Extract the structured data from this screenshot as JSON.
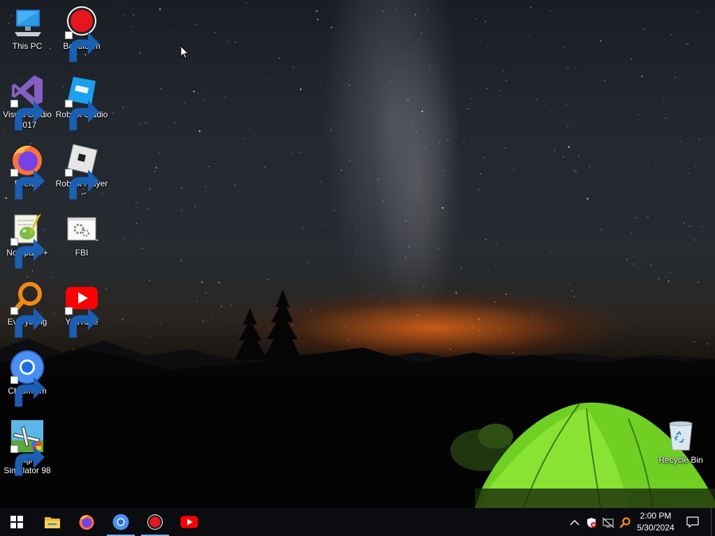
{
  "desktop": {
    "icons": [
      {
        "label": "This PC",
        "icon": "this-pc-icon"
      },
      {
        "label": "Bandicam",
        "icon": "bandicam-icon"
      },
      {
        "label": "Visual Studio\n2017",
        "icon": "visual-studio-icon"
      },
      {
        "label": "Roblox Studio",
        "icon": "roblox-studio-icon"
      },
      {
        "label": "Firefox",
        "icon": "firefox-icon"
      },
      {
        "label": "Roblox Player",
        "icon": "roblox-player-icon"
      },
      {
        "label": "Notepad++",
        "icon": "notepad-plus-plus-icon"
      },
      {
        "label": "FBI",
        "icon": "fbi-app-icon"
      },
      {
        "label": "Everything",
        "icon": "everything-search-icon"
      },
      {
        "label": "YouTube",
        "icon": "youtube-icon"
      },
      {
        "label": "Chromium",
        "icon": "chromium-icon"
      },
      {
        "label": "Flight\nSimulator 98",
        "icon": "flight-simulator-icon"
      },
      {
        "label": "Recycle Bin",
        "icon": "recycle-bin-icon"
      }
    ]
  },
  "taskbar": {
    "start": "windows-start-icon",
    "pinned": [
      "file-explorer-icon",
      "firefox-icon",
      "chromium-icon",
      "bandicam-icon",
      "youtube-icon"
    ],
    "running": [
      "chromium-icon",
      "bandicam-icon"
    ],
    "tray": [
      "chevron-up-icon",
      "security-shield-icon",
      "network-disconnected-icon",
      "everything-search-icon"
    ],
    "clock": {
      "time": "2:00 PM",
      "date": "5/30/2024"
    },
    "action_center": "notification-icon"
  },
  "colors": {
    "taskbar_bg": "#0b0c10",
    "running_indicator": "#76b9ed",
    "tent_green": "#7fe02a",
    "horizon_glow": "#ff6a14"
  }
}
